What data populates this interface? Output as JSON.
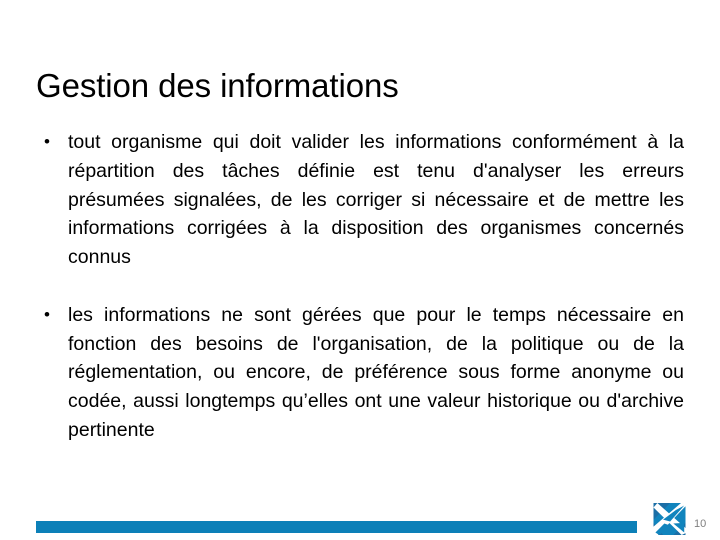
{
  "slide": {
    "title": "Gestion des informations",
    "bullets": [
      {
        "marker": "•",
        "text": "tout organisme qui doit valider les informations conformément à la répartition des tâches définie est tenu d'analyser les erreurs présumées signalées, de les corriger si nécessaire et de mettre les informations corrigées à la disposition des organismes concernés connus"
      },
      {
        "marker": "•",
        "text": "les informations ne sont gérées que pour le temps nécessaire en fonction des besoins de l'organisation, de la politique ou de la réglementation, ou encore, de préférence sous forme anonyme ou codée, aussi longtemps qu’elles ont une valeur historique ou d'archive pertinente"
      }
    ],
    "footer": {
      "page_number": "10",
      "logo_name": "saltire-swoosh-logo",
      "accent_color": "#0c80b8",
      "logo_dark_color": "#1b6ea6",
      "logo_light_color": "#1184bd",
      "page_number_color": "#7f7f7f"
    }
  }
}
